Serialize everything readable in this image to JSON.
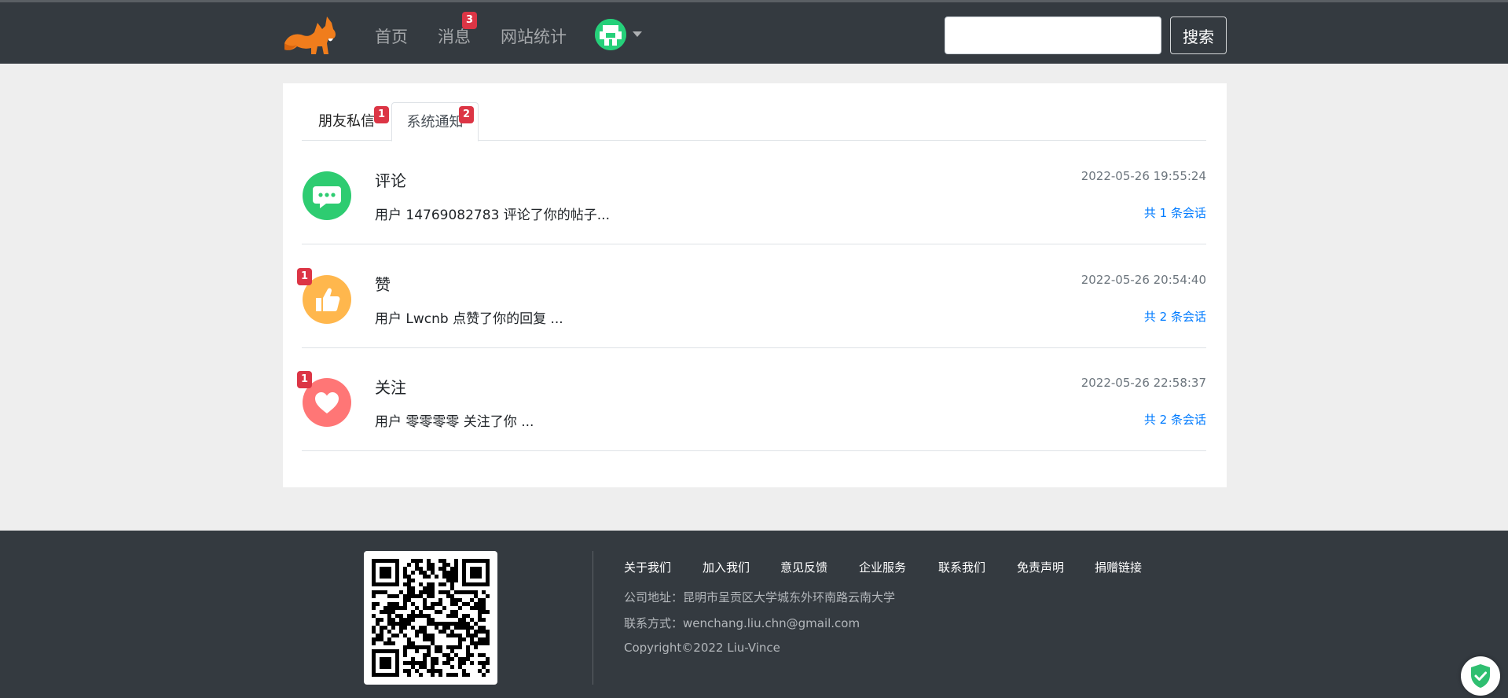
{
  "header": {
    "nav": {
      "home": "首页",
      "messages": "消息",
      "messages_badge": "3",
      "stats": "网站统计"
    },
    "search": {
      "value": "",
      "placeholder": "",
      "button": "搜索"
    }
  },
  "tabs": [
    {
      "label": "朋友私信",
      "badge": "1"
    },
    {
      "label": "系统通知",
      "badge": "2",
      "active": true
    }
  ],
  "notices": [
    {
      "title": "评论",
      "time": "2022-05-26 19:55:24",
      "body": "用户 14769082783 评论了你的帖子...",
      "count": "共 1 条会话",
      "badge": "",
      "icon": "comment-icon",
      "color": "#2ecc71"
    },
    {
      "title": "赞",
      "time": "2022-05-26 20:54:40",
      "body": "用户 Lwcnb 点赞了你的回复 ...",
      "count": "共 2 条会话",
      "badge": "1",
      "icon": "thumbs-up-icon",
      "color": "#ffb74d"
    },
    {
      "title": "关注",
      "time": "2022-05-26 22:58:37",
      "body": "用户 零零零零 关注了你 ...",
      "count": "共 2 条会话",
      "badge": "1",
      "icon": "heart-icon",
      "color": "#ff7676"
    }
  ],
  "footer": {
    "links": [
      "关于我们",
      "加入我们",
      "意见反馈",
      "企业服务",
      "联系我们",
      "免责声明",
      "捐赠链接"
    ],
    "address": "公司地址：昆明市呈贡区大学城东外环南路云南大学",
    "contact": "联系方式：wenchang.liu.chn@gmail.com",
    "copyright": "Copyright©2022 Liu-Vince"
  }
}
